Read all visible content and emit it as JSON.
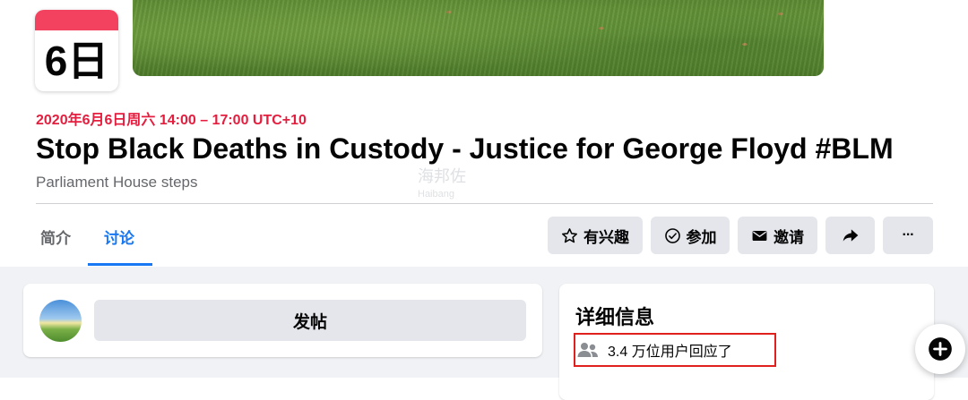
{
  "event": {
    "calendar_day": "6日",
    "datetime": "2020年6月6日周六 14:00 – 17:00 UTC+10",
    "title": "Stop Black Deaths in Custody - Justice for George Floyd #BLM",
    "location": "Parliament House steps"
  },
  "watermark": {
    "line1": "海邦佐",
    "line2": "Haibang"
  },
  "tabs": [
    {
      "label": "简介",
      "active": false
    },
    {
      "label": "讨论",
      "active": true
    }
  ],
  "actions": {
    "interested": {
      "label": "有兴趣",
      "icon": "star-icon"
    },
    "going": {
      "label": "参加",
      "icon": "check-circle-icon"
    },
    "invite": {
      "label": "邀请",
      "icon": "envelope-icon"
    },
    "share": {
      "icon": "share-arrow-icon"
    },
    "more": {
      "label": "···",
      "icon": "more-dots-icon"
    }
  },
  "composer": {
    "post_label": "发帖"
  },
  "details": {
    "title": "详细信息",
    "responses": "3.4 万位用户回应了",
    "responses_icon": "people-icon"
  },
  "fab": {
    "icon": "plus-circle-icon"
  },
  "colors": {
    "accent": "#1877f2",
    "date": "#e41e3f",
    "highlight": "#e0201c",
    "calendar_top": "#f3425f"
  }
}
